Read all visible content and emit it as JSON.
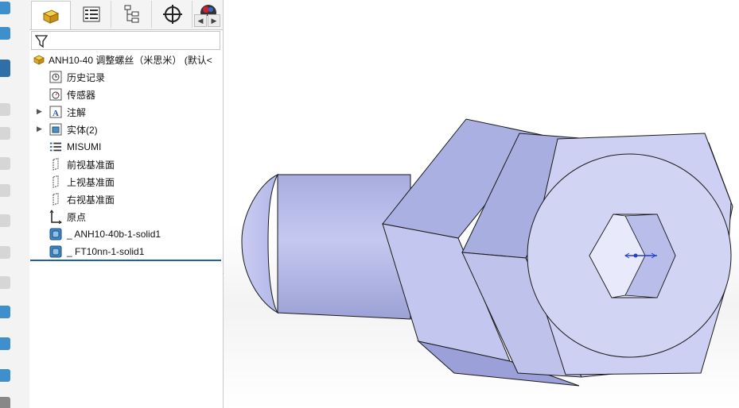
{
  "feature_tree": {
    "part_title": "ANH10-40 调整螺丝（米思米） (默认<",
    "items": [
      {
        "label": "历史记录",
        "icon": "history-icon"
      },
      {
        "label": "传感器",
        "icon": "sensor-icon"
      },
      {
        "label": "注解",
        "icon": "annotation-icon",
        "expandable": true
      },
      {
        "label": "实体(2)",
        "icon": "solid-bodies-icon",
        "expandable": true
      },
      {
        "label": "MISUMI",
        "icon": "misumi-icon"
      },
      {
        "label": "前视基准面",
        "icon": "plane-icon"
      },
      {
        "label": "上视基准面",
        "icon": "plane-icon"
      },
      {
        "label": "右视基准面",
        "icon": "plane-icon"
      },
      {
        "label": "原点",
        "icon": "origin-icon"
      },
      {
        "label": "_ ANH10-40b-1-solid1",
        "icon": "solid-feature-icon"
      },
      {
        "label": "_ FT10nn-1-solid1",
        "icon": "solid-feature-icon"
      }
    ]
  },
  "tabs": [
    {
      "name": "feature-manager",
      "icon": "feature-manager-icon"
    },
    {
      "name": "property-manager",
      "icon": "property-manager-icon"
    },
    {
      "name": "configuration-manager",
      "icon": "configuration-manager-icon"
    },
    {
      "name": "dimxpert-manager",
      "icon": "crosshair-icon"
    },
    {
      "name": "display-manager",
      "icon": "display-manager-icon"
    }
  ],
  "colors": {
    "model_face": "#c8cbef",
    "model_face_dark": "#a9aee0",
    "model_edge": "#1a1a1a",
    "selection_blue": "#1f5fa8",
    "icon_blue": "#2d7ab8"
  }
}
